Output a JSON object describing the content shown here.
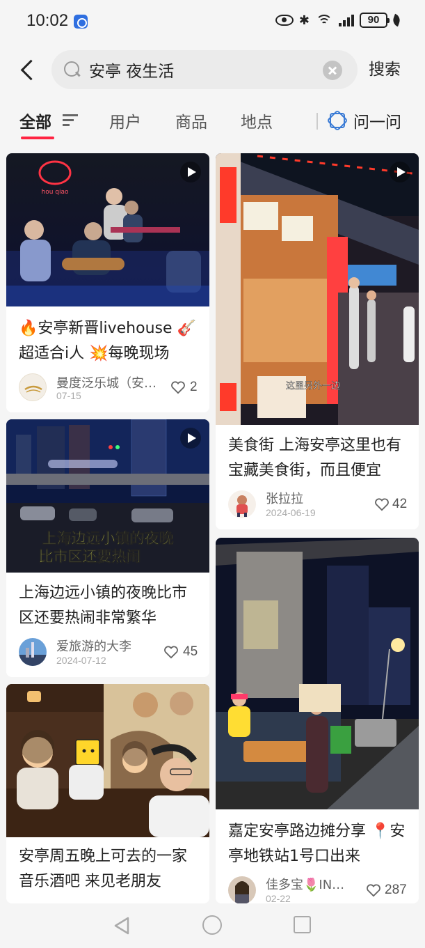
{
  "status_bar": {
    "time": "10:02",
    "battery": "90"
  },
  "search": {
    "query": "安亭 夜生活",
    "button_label": "搜索"
  },
  "tabs": [
    {
      "label": "全部"
    },
    {
      "label": "用户"
    },
    {
      "label": "商品"
    },
    {
      "label": "地点"
    },
    {
      "label": "问一问"
    }
  ],
  "feed": {
    "left": [
      {
        "title": "🔥安亭新晋livehouse 🎸超适合i人 💥每晚现场",
        "author": "曼度泛乐城（安亭店）",
        "date": "07-15",
        "likes": "2",
        "video": true,
        "image_sign": "hou qiao"
      },
      {
        "title": "上海边远小镇的夜晚比市区还要热闹非常繁华",
        "author": "爱旅游的大李",
        "date": "2024-07-12",
        "likes": "45",
        "video": true,
        "image_caption_line1": "上海边远小镇的夜晚",
        "image_caption_line2": "比市区还要热闹"
      },
      {
        "title": "安亭周五晚上可去的一家音乐酒吧 来见老朋友",
        "author": "",
        "date": "",
        "likes": "",
        "video": false
      }
    ],
    "right": [
      {
        "title": "美食街 上海安亭这里也有宝藏美食街，而且便宜",
        "author": "张拉拉",
        "date": "2024-06-19",
        "likes": "42",
        "video": true,
        "image_caption": "这里另外一边"
      },
      {
        "title": "嘉定安亭路边摊分享 📍安亭地铁站1号口出来",
        "author": "佳多宝🌷IN…",
        "date": "02-22",
        "likes": "287",
        "video": false
      }
    ]
  },
  "colors": {
    "accent": "#ff2442",
    "ask_blue": "#3a7bd5"
  }
}
